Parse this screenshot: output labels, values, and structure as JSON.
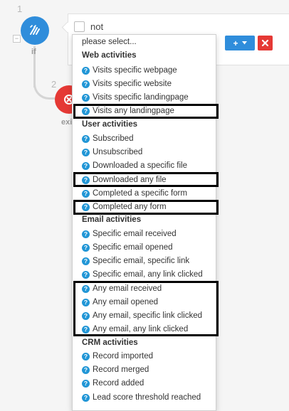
{
  "flow": {
    "if_node": {
      "step": "1",
      "caption": "if"
    },
    "exit_node": {
      "step": "2",
      "caption": "exi"
    }
  },
  "condition_panel": {
    "not_label": "not",
    "add_button_label": "+"
  },
  "dropdown": {
    "placeholder": "please select...",
    "groups": [
      {
        "label": "Web activities",
        "options": [
          "Visits specific webpage",
          "Visits specific website",
          "Visits specific landingpage",
          "Visits any landingpage"
        ]
      },
      {
        "label": "User activities",
        "options": [
          "Subscribed",
          "Unsubscribed",
          "Downloaded a specific file",
          "Downloaded any file",
          "Completed a specific form",
          "Completed any form"
        ]
      },
      {
        "label": "Email activities",
        "options": [
          "Specific email received",
          "Specific email opened",
          "Specific email, specific link",
          "Specific email, any link clicked",
          "Any email received",
          "Any email opened",
          "Any email, specific link clicked",
          "Any email, any link clicked"
        ]
      },
      {
        "label": "CRM activities",
        "options": [
          "Record imported",
          "Record merged",
          "Record added",
          "Lead score threshold reached"
        ]
      }
    ]
  },
  "colors": {
    "accent_blue": "#2f8ddb",
    "danger_red": "#e53935",
    "help_icon_blue": "#2196d6",
    "highlight_border": "#000000"
  },
  "icons": {
    "if_node": "split-fork-icon",
    "exit_node": "exit-icon",
    "add": "plus-icon",
    "remove": "close-icon",
    "option": "question-circle-icon"
  }
}
